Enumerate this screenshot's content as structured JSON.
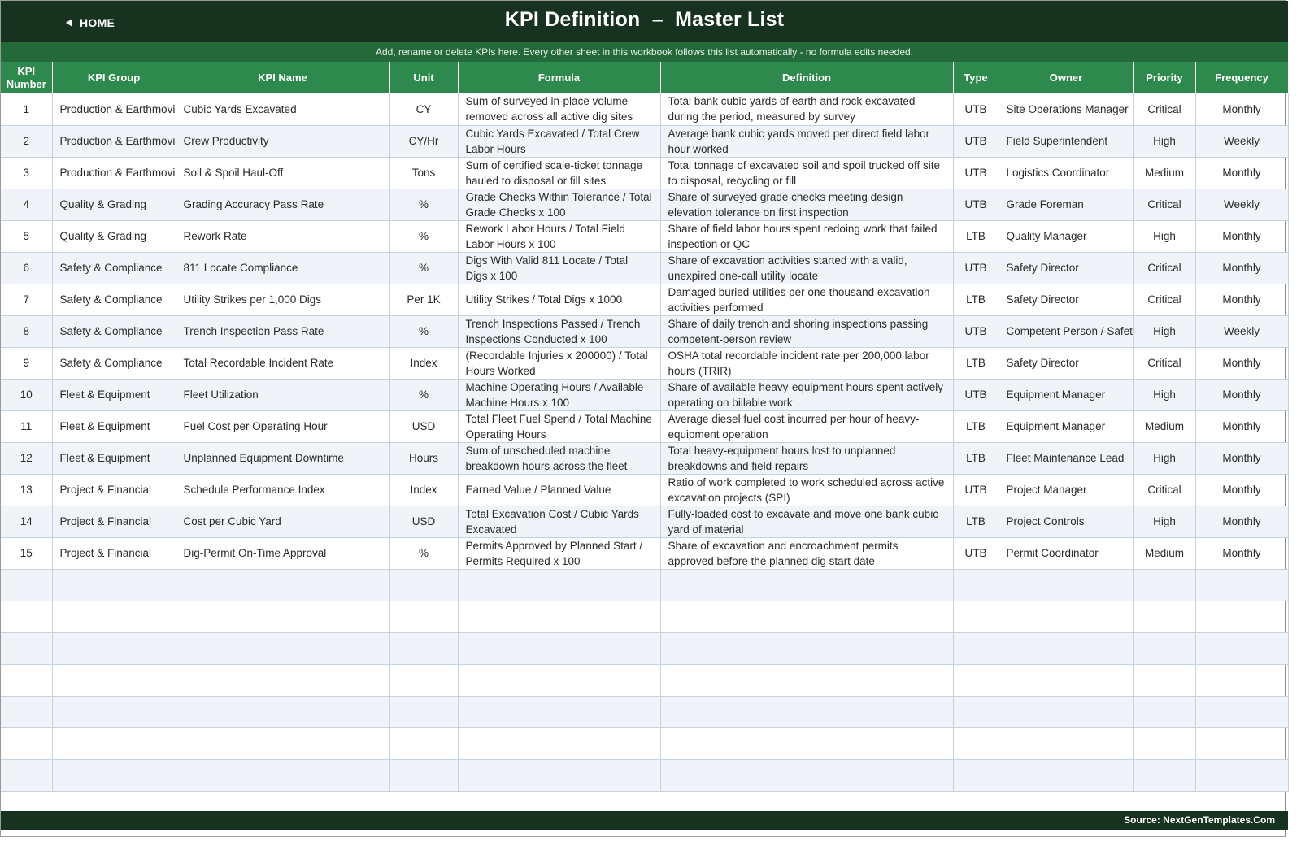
{
  "header": {
    "home_label": "HOME",
    "title": "KPI Definition  –  Master List"
  },
  "subbar": {
    "text": "Add, rename or delete KPIs here. Every other sheet in this workbook follows this list automatically - no formula edits needed."
  },
  "columns": [
    "KPI Number",
    "KPI Group",
    "KPI Name",
    "Unit",
    "Formula",
    "Definition",
    "Type",
    "Owner",
    "Priority",
    "Frequency"
  ],
  "rows": [
    [
      "1",
      "Production & Earthmovi",
      "Cubic Yards Excavated",
      "CY",
      "Sum of surveyed in-place volume removed across all active dig sites",
      "Total bank cubic yards of earth and rock excavated during the period, measured by survey",
      "UTB",
      "Site Operations Manager",
      "Critical",
      "Monthly"
    ],
    [
      "2",
      "Production & Earthmovi",
      "Crew Productivity",
      "CY/Hr",
      "Cubic Yards Excavated / Total Crew Labor Hours",
      "Average bank cubic yards moved per direct field labor hour worked",
      "UTB",
      "Field Superintendent",
      "High",
      "Weekly"
    ],
    [
      "3",
      "Production & Earthmovi",
      "Soil & Spoil Haul-Off",
      "Tons",
      "Sum of certified scale-ticket tonnage hauled to disposal or fill sites",
      "Total tonnage of excavated soil and spoil trucked off site to disposal, recycling or fill",
      "UTB",
      "Logistics Coordinator",
      "Medium",
      "Monthly"
    ],
    [
      "4",
      "Quality & Grading",
      "Grading Accuracy Pass Rate",
      "%",
      "Grade Checks Within Tolerance / Total Grade Checks x 100",
      "Share of surveyed grade checks meeting design elevation tolerance on first inspection",
      "UTB",
      "Grade Foreman",
      "Critical",
      "Weekly"
    ],
    [
      "5",
      "Quality & Grading",
      "Rework Rate",
      "%",
      "Rework Labor Hours / Total Field Labor Hours x 100",
      "Share of field labor hours spent redoing work that failed inspection or QC",
      "LTB",
      "Quality Manager",
      "High",
      "Monthly"
    ],
    [
      "6",
      "Safety & Compliance",
      "811 Locate Compliance",
      "%",
      "Digs With Valid 811 Locate / Total Digs x 100",
      "Share of excavation activities started with a valid, unexpired one-call utility locate",
      "UTB",
      "Safety Director",
      "Critical",
      "Monthly"
    ],
    [
      "7",
      "Safety & Compliance",
      "Utility Strikes per 1,000 Digs",
      "Per 1K",
      "Utility Strikes / Total Digs x 1000",
      "Damaged buried utilities per one thousand excavation activities performed",
      "LTB",
      "Safety Director",
      "Critical",
      "Monthly"
    ],
    [
      "8",
      "Safety & Compliance",
      "Trench Inspection Pass Rate",
      "%",
      "Trench Inspections Passed / Trench Inspections Conducted x 100",
      "Share of daily trench and shoring inspections passing competent-person review",
      "UTB",
      "Competent Person / Safety",
      "High",
      "Weekly"
    ],
    [
      "9",
      "Safety & Compliance",
      "Total Recordable Incident Rate",
      "Index",
      "(Recordable Injuries x 200000) / Total Hours Worked",
      "OSHA total recordable incident rate per 200,000 labor hours (TRIR)",
      "LTB",
      "Safety Director",
      "Critical",
      "Monthly"
    ],
    [
      "10",
      "Fleet & Equipment",
      "Fleet Utilization",
      "%",
      "Machine Operating Hours / Available Machine Hours x 100",
      "Share of available heavy-equipment hours spent actively operating on billable work",
      "UTB",
      "Equipment Manager",
      "High",
      "Monthly"
    ],
    [
      "11",
      "Fleet & Equipment",
      "Fuel Cost per Operating Hour",
      "USD",
      "Total Fleet Fuel Spend / Total Machine Operating Hours",
      "Average diesel fuel cost incurred per hour of heavy-equipment operation",
      "LTB",
      "Equipment Manager",
      "Medium",
      "Monthly"
    ],
    [
      "12",
      "Fleet & Equipment",
      "Unplanned Equipment Downtime",
      "Hours",
      "Sum of unscheduled machine breakdown hours across the fleet",
      "Total heavy-equipment hours lost to unplanned breakdowns and field repairs",
      "LTB",
      "Fleet Maintenance Lead",
      "High",
      "Monthly"
    ],
    [
      "13",
      "Project & Financial",
      "Schedule Performance Index",
      "Index",
      "Earned Value / Planned Value",
      "Ratio of work completed to work scheduled across active excavation projects (SPI)",
      "UTB",
      "Project Manager",
      "Critical",
      "Monthly"
    ],
    [
      "14",
      "Project & Financial",
      "Cost per Cubic Yard",
      "USD",
      "Total Excavation Cost / Cubic Yards Excavated",
      "Fully-loaded cost to excavate and move one bank cubic yard of material",
      "LTB",
      "Project Controls",
      "High",
      "Monthly"
    ],
    [
      "15",
      "Project & Financial",
      "Dig-Permit On-Time Approval",
      "%",
      "Permits Approved by Planned Start / Permits Required x 100",
      "Share of excavation and encroachment permits approved before the planned dig start date",
      "UTB",
      "Permit Coordinator",
      "Medium",
      "Monthly"
    ]
  ],
  "footer": {
    "source": "Source: NextGenTemplates.Com"
  },
  "colors": {
    "header_bg": "#17331f",
    "subbar_bg": "#24693a",
    "column_header_bg": "#2e8a4c",
    "alt_row_bg": "#f0f4f8"
  }
}
